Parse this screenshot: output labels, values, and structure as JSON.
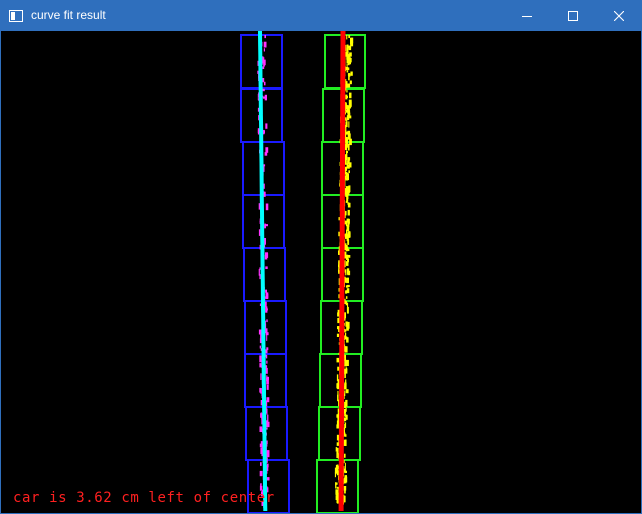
{
  "window": {
    "title": "curve fit result",
    "title_icon": "window-app-icon",
    "controls": {
      "minimize_icon": "minimize-icon",
      "maximize_icon": "maximize-icon",
      "close_icon": "close-icon"
    }
  },
  "image": {
    "status_text": "car is 3.62 cm left of center",
    "colors": {
      "background": "#000000",
      "left_windows": "#1a1aff",
      "right_windows": "#22ee22",
      "left_pixels": "#ff33ff",
      "right_pixels": "#ffff00",
      "left_fit": "#00ffff",
      "right_fit": "#ff0000",
      "status_text": "#ff2020",
      "titlebar": "#2f6fbd"
    }
  }
}
